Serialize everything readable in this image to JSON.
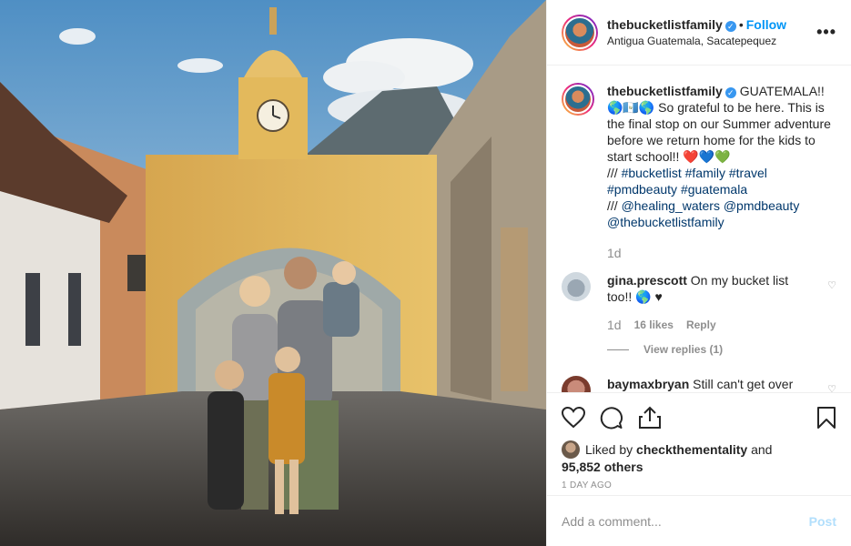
{
  "post": {
    "username": "thebucketlistfamily",
    "verified_glyph": "✓",
    "separator": "•",
    "follow_label": "Follow",
    "location": "Antigua Guatemala, Sacatepequez",
    "more_label": "•••"
  },
  "caption": {
    "username": "thebucketlistfamily",
    "text_lead": " GUATEMALA!! 🌎🇬🇹🌎 So grateful to be here. This is the final stop on our Summer adventure before we return home for the kids to start school!! ❤️💙💚",
    "line2_prefix": "/// ",
    "hashtags": [
      "#bucketlist",
      "#family",
      "#travel",
      "#pmdbeauty",
      "#guatemala"
    ],
    "line3_prefix": "/// ",
    "mentions": [
      "@healing_waters",
      "@pmdbeauty",
      "@thebucketlistfamily"
    ],
    "age": "1d"
  },
  "comments": [
    {
      "username": "gina.prescott",
      "text": " On my bucket list too!! 🌎 ♥",
      "age": "1d",
      "likes": "16 likes",
      "reply_label": "Reply",
      "view_replies": "View replies (1)",
      "heart": "♡"
    },
    {
      "username": "baymaxbryan",
      "text": " Still can't get over",
      "heart": "♡"
    }
  ],
  "actions": {
    "icons": [
      "heart-icon",
      "comment-icon",
      "share-icon",
      "bookmark-icon"
    ]
  },
  "likes": {
    "prefix": "Liked by ",
    "user": "checkthementality",
    "middle": " and",
    "count": "95,852 others"
  },
  "time_ago": "1 DAY AGO",
  "add_comment": {
    "placeholder": "Add a comment...",
    "post_label": "Post"
  },
  "colors": {
    "link": "#00376b",
    "follow": "#0095f6",
    "muted": "#8e8e8e"
  }
}
